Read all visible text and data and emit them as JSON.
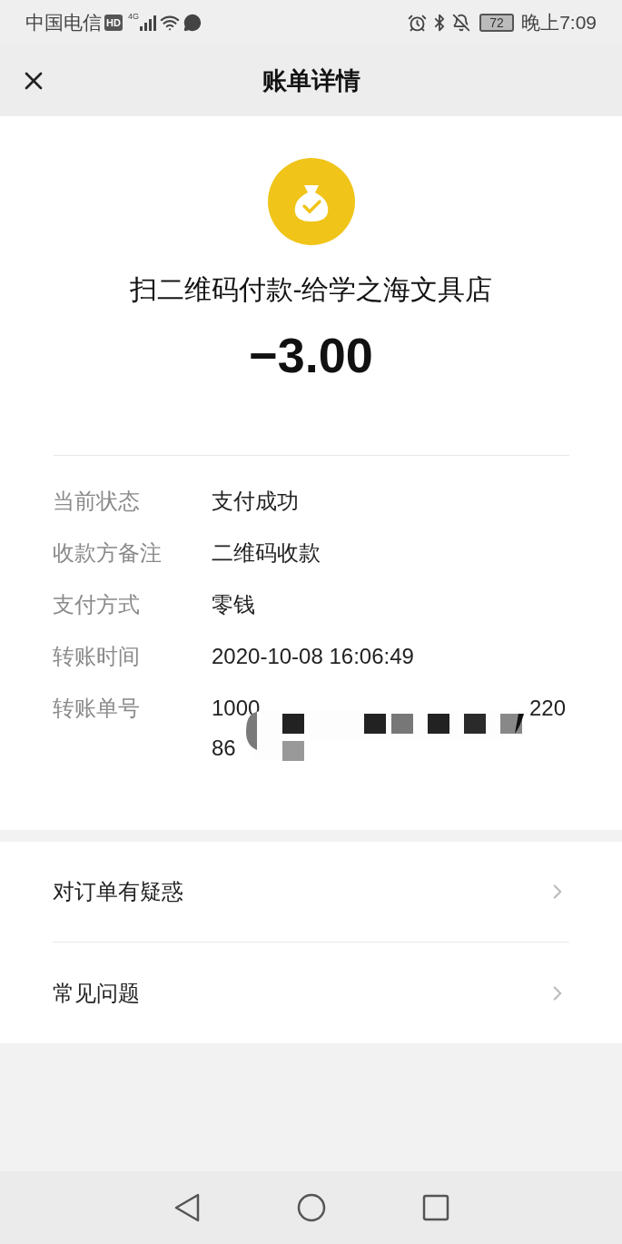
{
  "status_bar": {
    "carrier": "中国电信",
    "hd": "HD",
    "network": "4G",
    "battery": "72",
    "time": "晚上7:09"
  },
  "header": {
    "title": "账单详情"
  },
  "summary": {
    "merchant": "扫二维码付款-给学之海文具店",
    "amount": "−3.00"
  },
  "details": [
    {
      "label": "当前状态",
      "value": "支付成功"
    },
    {
      "label": "收款方备注",
      "value": "二维码收款"
    },
    {
      "label": "支付方式",
      "value": "零钱"
    },
    {
      "label": "转账时间",
      "value": "2020-10-08 16:06:49"
    }
  ],
  "transfer_no": {
    "label": "转账单号",
    "line1_start": "1000",
    "line1_end": "220",
    "line2_start": "86",
    "redacted": true
  },
  "menu": [
    {
      "label": "对订单有疑惑"
    },
    {
      "label": "常见问题"
    }
  ]
}
